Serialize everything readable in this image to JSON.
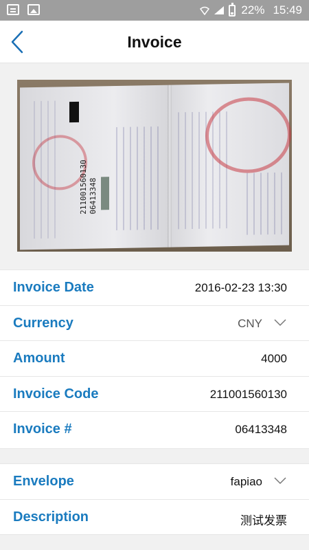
{
  "status_bar": {
    "battery_percent": "22%",
    "time": "15:49"
  },
  "header": {
    "title": "Invoice"
  },
  "photo": {
    "icon": "invoice-photo",
    "code_text": "211001560130",
    "number_text": "06413348"
  },
  "fields": [
    {
      "label": "Invoice Date",
      "value": "2016-02-23 13:30"
    },
    {
      "label": "Currency",
      "value": "CNY"
    },
    {
      "label": "Amount",
      "value": "4000"
    },
    {
      "label": "Invoice Code",
      "value": "211001560130"
    },
    {
      "label": "Invoice #",
      "value": "06413348"
    }
  ],
  "extra": [
    {
      "label": "Envelope",
      "value": "fapiao"
    },
    {
      "label": "Description",
      "value": "测试发票"
    }
  ],
  "colors": {
    "label_blue": "#1a7bbf",
    "status_bar": "#9e9e9e"
  }
}
